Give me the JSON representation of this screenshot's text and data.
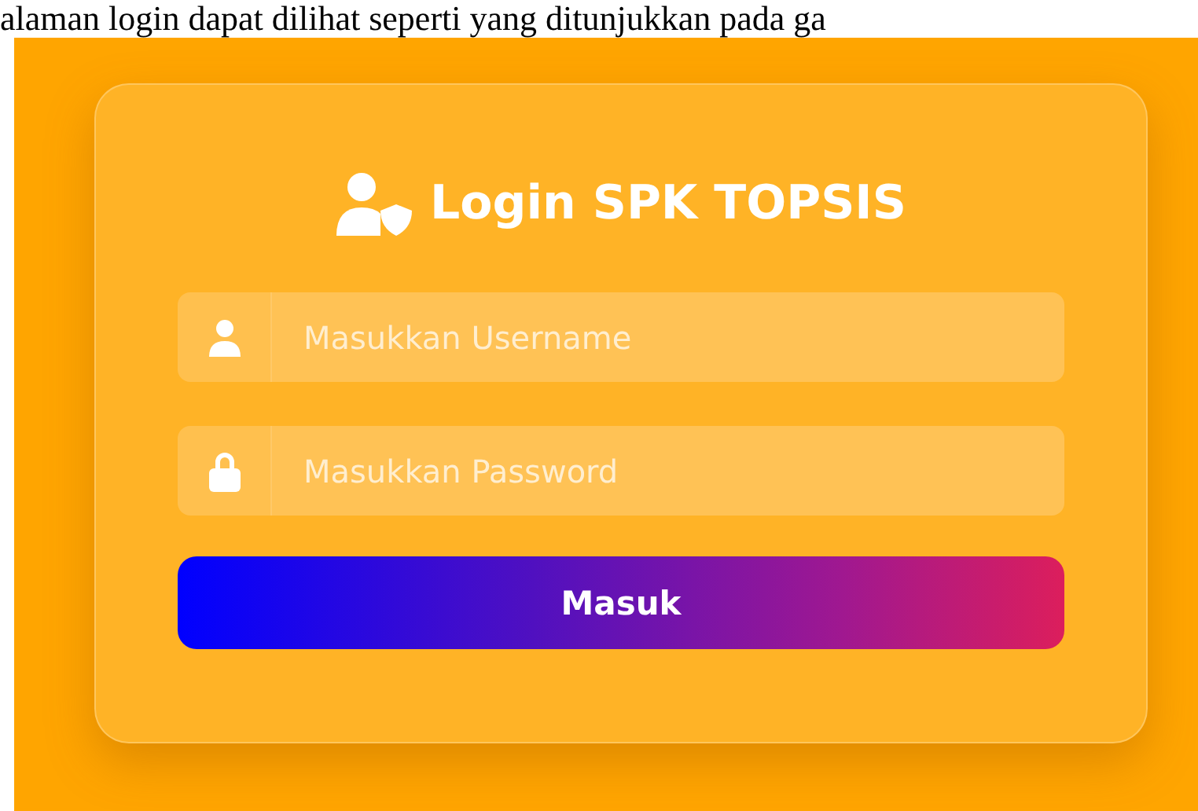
{
  "caption": "alaman login dapat dilihat seperti yang ditunjukkan pada ga",
  "login": {
    "title": "Login SPK TOPSIS",
    "fields": [
      {
        "kind": "text",
        "placeholder": "Masukkan Username"
      },
      {
        "kind": "password",
        "placeholder": "Masukkan Password"
      }
    ],
    "submit": "Masuk"
  }
}
